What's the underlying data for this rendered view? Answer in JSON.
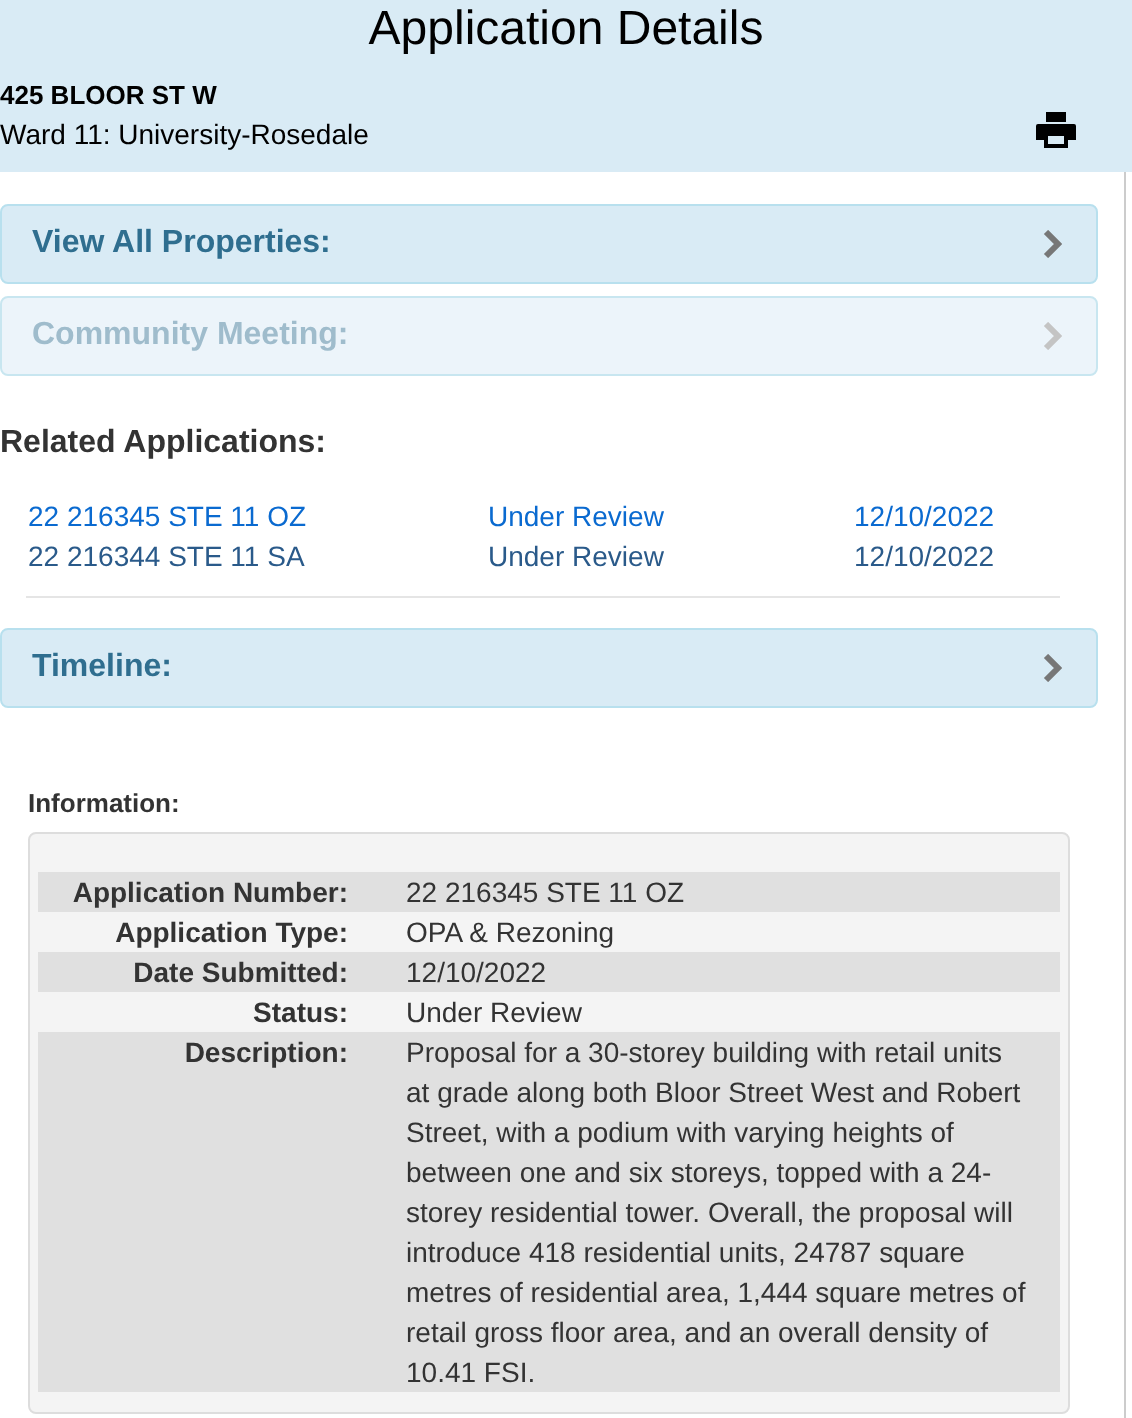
{
  "header": {
    "title": "Application Details",
    "address": "425 BLOOR ST W",
    "ward": "Ward 11: University-Rosedale"
  },
  "sections_top": [
    {
      "label": "View All Properties:",
      "disabled": false
    },
    {
      "label": "Community Meeting:",
      "disabled": true
    }
  ],
  "related": {
    "heading": "Related Applications:",
    "rows": [
      {
        "number": "22 216345 STE 11 OZ",
        "status": "Under Review",
        "date": "12/10/2022",
        "visited": false
      },
      {
        "number": "22 216344 STE 11 SA",
        "status": "Under Review",
        "date": "12/10/2022",
        "visited": true
      }
    ]
  },
  "sections_bottom": [
    {
      "label": "Timeline:",
      "disabled": false
    }
  ],
  "information": {
    "heading": "Information:",
    "rows": [
      {
        "label": "Application Number:",
        "value": "22 216345 STE 11 OZ"
      },
      {
        "label": "Application Type:",
        "value": "OPA & Rezoning"
      },
      {
        "label": "Date Submitted:",
        "value": "12/10/2022"
      },
      {
        "label": "Status:",
        "value": "Under Review"
      },
      {
        "label": "Description:",
        "value": "Proposal for a 30-storey building with retail units at grade along both Bloor Street West and Robert Street, with a podium with varying heights of between one and six storeys, topped with a 24-storey residential tower. Overall, the proposal will introduce 418 residential units, 24787 square metres of residential area, 1,444 square metres of retail gross floor area, and an overall density of 10.41 FSI."
      }
    ]
  }
}
